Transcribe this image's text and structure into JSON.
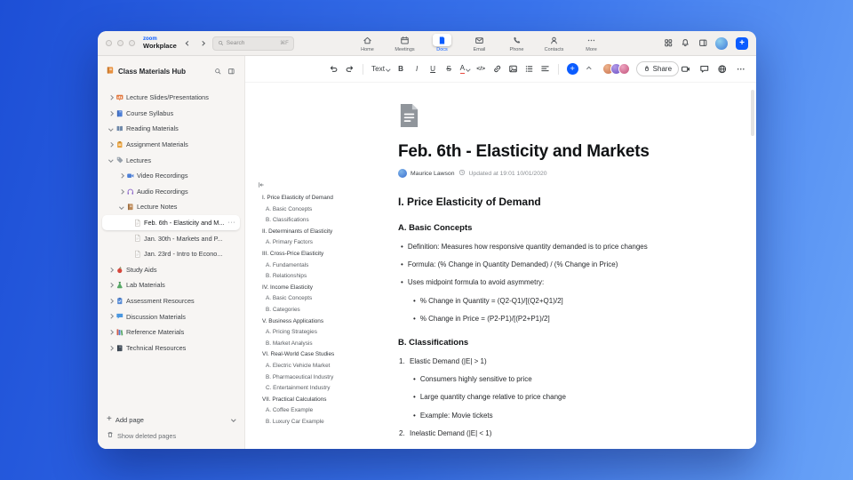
{
  "titlebar": {
    "brand_zoom": "zoom",
    "brand_workplace": "Workplace",
    "search_placeholder": "Search",
    "search_shortcut": "⌘F",
    "nav": [
      {
        "name": "home",
        "label": "Home"
      },
      {
        "name": "meetings",
        "label": "Meetings"
      },
      {
        "name": "docs",
        "label": "Docs",
        "active": true
      },
      {
        "name": "email",
        "label": "Email"
      },
      {
        "name": "phone",
        "label": "Phone"
      },
      {
        "name": "contacts",
        "label": "Contacts"
      },
      {
        "name": "more",
        "label": "More"
      }
    ],
    "right_icons": [
      "apps",
      "notifications",
      "side-panel"
    ]
  },
  "sidebar": {
    "title": "Class Materials Hub",
    "items": [
      {
        "label": "Lecture Slides/Presentations",
        "icon": "slides",
        "level": 0,
        "chevron": "right"
      },
      {
        "label": "Course Syllabus",
        "icon": "syllabus",
        "level": 0,
        "chevron": "right"
      },
      {
        "label": "Reading Materials",
        "icon": "reading",
        "level": 0,
        "chevron": "down"
      },
      {
        "label": "Assignment Materials",
        "icon": "assignment",
        "level": 0,
        "chevron": "right"
      },
      {
        "label": "Lectures",
        "icon": "lectures",
        "level": 0,
        "chevron": "down"
      },
      {
        "label": "Video Recordings",
        "icon": "video",
        "level": 1,
        "chevron": "right"
      },
      {
        "label": "Audio Recordings",
        "icon": "audio",
        "level": 1,
        "chevron": "right"
      },
      {
        "label": "Lecture Notes",
        "icon": "notes",
        "level": 1,
        "chevron": "down"
      },
      {
        "label": "Feb. 6th - Elasticity and M...",
        "icon": "page",
        "level": 2,
        "selected": true
      },
      {
        "label": "Jan. 30th - Markets and P...",
        "icon": "page",
        "level": 2
      },
      {
        "label": "Jan. 23rd - Intro to Econo...",
        "icon": "page",
        "level": 2
      },
      {
        "label": "Study Aids",
        "icon": "study",
        "level": 0,
        "chevron": "right"
      },
      {
        "label": "Lab Materials",
        "icon": "lab",
        "level": 0,
        "chevron": "right"
      },
      {
        "label": "Assessment Resources",
        "icon": "assessment",
        "level": 0,
        "chevron": "right"
      },
      {
        "label": "Discussion Materials",
        "icon": "discussion",
        "level": 0,
        "chevron": "right"
      },
      {
        "label": "Reference Materials",
        "icon": "reference",
        "level": 0,
        "chevron": "right"
      },
      {
        "label": "Technical Resources",
        "icon": "technical",
        "level": 0,
        "chevron": "right"
      }
    ],
    "add_page": "Add page",
    "show_deleted": "Show deleted pages"
  },
  "toolbar": {
    "items": [
      "undo",
      "redo",
      "divider",
      "text-style",
      "bold",
      "italic",
      "underline",
      "strikethrough",
      "text-color",
      "code",
      "link",
      "image",
      "bulleted-list",
      "align",
      "divider",
      "insert",
      "collapse-toolbar"
    ],
    "text_style_label": "Text",
    "share_label": "Share",
    "collaborators": [
      {
        "color": "#c96f4a",
        "light": "#edb48e"
      },
      {
        "color": "#6a4ec2",
        "light": "#b39ae8"
      },
      {
        "color": "#c2527a",
        "light": "#eda4c0"
      }
    ],
    "right_items": [
      "video-call",
      "comment",
      "globe",
      "more"
    ]
  },
  "doc": {
    "title": "Feb. 6th - Elasticity and Markets",
    "author": "Maurice Lawson",
    "updated": "Updated at 19:01 10/01/2020",
    "toc": [
      {
        "label": "I. Price Elasticity of Demand",
        "level": 0
      },
      {
        "label": "A. Basic Concepts",
        "level": 1
      },
      {
        "label": "B. Classifications",
        "level": 1
      },
      {
        "label": "II. Determinants of Elasticity",
        "level": 0
      },
      {
        "label": "A. Primary Factors",
        "level": 1
      },
      {
        "label": "III. Cross-Price Elasticity",
        "level": 0
      },
      {
        "label": "A. Fundamentals",
        "level": 1
      },
      {
        "label": "B. Relationships",
        "level": 1
      },
      {
        "label": "IV. Income Elasticity",
        "level": 0
      },
      {
        "label": "A. Basic Concepts",
        "level": 1
      },
      {
        "label": "B. Categories",
        "level": 1
      },
      {
        "label": "V. Business Applications",
        "level": 0
      },
      {
        "label": "A. Pricing Strategies",
        "level": 1
      },
      {
        "label": "B. Market Analysis",
        "level": 1
      },
      {
        "label": "VI. Real-World Case Studies",
        "level": 0
      },
      {
        "label": "A. Electric Vehicle Market",
        "level": 1
      },
      {
        "label": "B. Pharmaceutical Industry",
        "level": 1
      },
      {
        "label": "C. Entertainment Industry",
        "level": 1
      },
      {
        "label": "VII. Practical Calculations",
        "level": 0
      },
      {
        "label": "A. Coffee Example",
        "level": 1
      },
      {
        "label": "B. Luxury Car Example",
        "level": 1
      }
    ],
    "content": [
      {
        "type": "h2",
        "text": "I. Price Elasticity of Demand"
      },
      {
        "type": "h3",
        "text": "A. Basic Concepts"
      },
      {
        "type": "bullet",
        "level": 1,
        "text": "Definition: Measures how responsive quantity demanded is to price changes"
      },
      {
        "type": "bullet",
        "level": 1,
        "text": "Formula: (% Change in Quantity Demanded) / (% Change in Price)"
      },
      {
        "type": "bullet",
        "level": 1,
        "text": "Uses midpoint formula to avoid asymmetry:"
      },
      {
        "type": "bullet",
        "level": 2,
        "text": "% Change in Quantity = (Q2-Q1)/[(Q2+Q1)/2]"
      },
      {
        "type": "bullet",
        "level": 2,
        "text": "% Change in Price = (P2-P1)/[(P2+P1)/2]"
      },
      {
        "type": "h3",
        "text": "B. Classifications"
      },
      {
        "type": "number",
        "marker": "1.",
        "text": "Elastic Demand (|E| > 1)"
      },
      {
        "type": "bullet",
        "level": 2,
        "text": "Consumers highly sensitive to price"
      },
      {
        "type": "bullet",
        "level": 2,
        "text": "Large quantity change relative to price change"
      },
      {
        "type": "bullet",
        "level": 2,
        "text": "Example: Movie tickets"
      },
      {
        "type": "number",
        "marker": "2.",
        "text": "Inelastic Demand (|E| < 1)"
      }
    ]
  },
  "colors": {
    "accent_blue": "#0b5cff",
    "background_start": "#1d4fd6",
    "background_end": "#69a3f7"
  }
}
